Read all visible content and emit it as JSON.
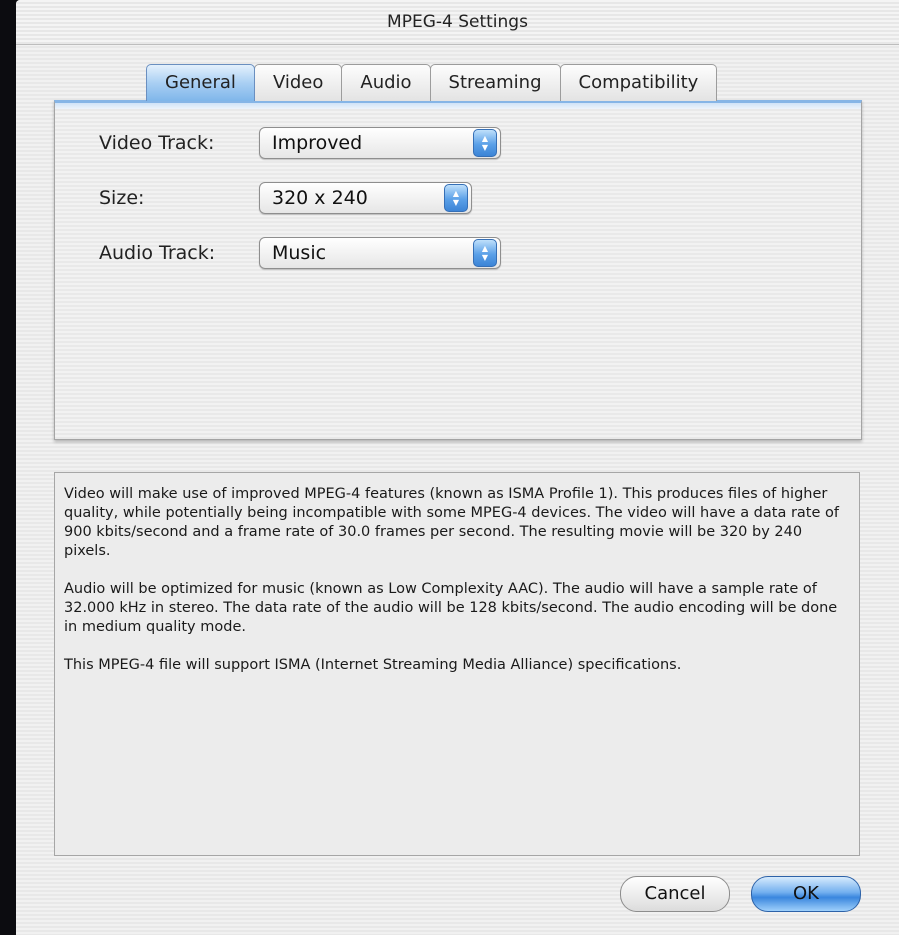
{
  "window": {
    "title": "MPEG-4 Settings"
  },
  "tabs": [
    {
      "label": "General",
      "selected": true
    },
    {
      "label": "Video",
      "selected": false
    },
    {
      "label": "Audio",
      "selected": false
    },
    {
      "label": "Streaming",
      "selected": false
    },
    {
      "label": "Compatibility",
      "selected": false
    }
  ],
  "general": {
    "video_track": {
      "label": "Video Track:",
      "value": "Improved"
    },
    "size": {
      "label": "Size:",
      "value": "320 x 240"
    },
    "audio_track": {
      "label": "Audio Track:",
      "value": "Music"
    }
  },
  "description": {
    "paragraphs": [
      "Video will make use of improved MPEG-4 features (known as ISMA Profile 1).  This produces files of higher quality, while potentially being incompatible with some MPEG-4 devices.  The video will have a data rate of 900 kbits/second and a frame rate of 30.0 frames per second.  The resulting movie will be 320 by 240 pixels.",
      "Audio will be optimized for music (known as Low Complexity AAC).  The audio will have a sample rate of 32.000 kHz in stereo. The data rate of the audio will be 128 kbits/second.  The audio encoding will be done in medium quality mode.",
      "This MPEG-4 file will support ISMA (Internet Streaming Media Alliance) specifications."
    ]
  },
  "buttons": {
    "cancel": "Cancel",
    "ok": "OK"
  },
  "colors": {
    "accent": "#5aa0e8",
    "tab_selected": "#a9cff3"
  }
}
